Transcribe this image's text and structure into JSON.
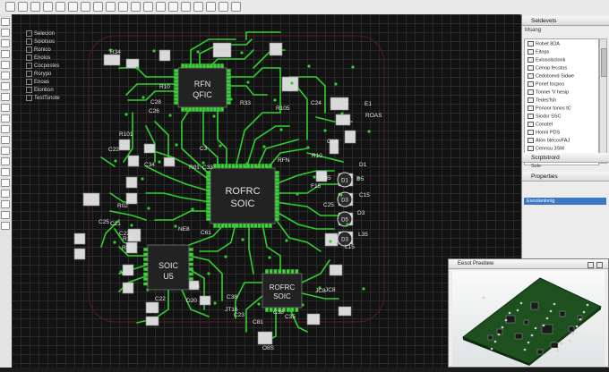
{
  "toolbar": {
    "icons": [
      "new-icon",
      "open-icon",
      "save-icon",
      "print-icon",
      "cut-icon",
      "copy-icon",
      "paste-icon",
      "undo-icon",
      "redo-icon",
      "zoom-in-icon",
      "zoom-out-icon",
      "route-icon",
      "grid-icon",
      "layer-icon",
      "drc-icon",
      "3d-icon",
      "export-icon",
      "settings-icon",
      "help-icon"
    ]
  },
  "left_toolbar": {
    "icons": [
      "pointer-icon",
      "select-icon",
      "move-icon",
      "wire-icon",
      "via-icon",
      "pad-icon",
      "arc-icon",
      "circle-icon",
      "text-icon",
      "dimension-icon",
      "polygon-icon",
      "keepout-icon",
      "measure-icon",
      "component-icon",
      "net-icon",
      "layer-icon",
      "zoom-icon",
      "pan-icon",
      "inspect-icon",
      "drc-icon"
    ]
  },
  "selection_panel": {
    "items": [
      "Selecion",
      "Solotsos",
      "Ronico",
      "Enolos",
      "Cocpostes",
      "Rorypo",
      "Enoas",
      "Elonbsn",
      "TestTsnote"
    ]
  },
  "board": {
    "chips": {
      "qfic": [
        "RFN",
        "QFIC"
      ],
      "soic_main": [
        "ROFRC",
        "SOIC"
      ],
      "soic_u5": [
        "SOIC",
        "U5"
      ],
      "soic_small": [
        "ROFRC",
        "SOIC"
      ]
    },
    "labels": [
      "R34",
      "R10",
      "C28",
      "C26",
      "R33",
      "R105",
      "C24",
      "R101",
      "C22",
      "C34",
      "C3",
      "R01",
      "C33",
      "R02",
      "C25",
      "C21",
      "C22",
      "NE8",
      "C61",
      "R32",
      "R33",
      "C23",
      "C22",
      "C38",
      "D20",
      "C38",
      "JT16",
      "C23",
      "C81",
      "C35",
      "C38",
      "JC8",
      "O8S",
      "JC8",
      "RFN",
      "R10",
      "C14",
      "F15",
      "C25",
      "L15",
      "L35",
      "C15",
      "D5",
      "D3",
      "D1",
      "X45",
      "E1",
      "ROAS"
    ],
    "resonators": [
      "D1",
      "D3",
      "D5",
      "D3",
      "D1"
    ]
  },
  "right_panel": {
    "selected_header": "Seldevets",
    "tree_title": "Msang",
    "tree_items": [
      "Robet 8DA",
      "Eitops",
      "Exlosolsclonk",
      "Cenop fecstos",
      "Cedotoevd Sidwe",
      "Ponet tocpos",
      "Tonnei 'V hesip",
      "Tedes'fsh",
      "Ponoor tonos tC",
      "Siodsr SSC",
      "Conotel",
      "Honni PDS",
      "Aton blecovFAJ",
      "Cennsu 3SM",
      "Tsibsun Tel"
    ],
    "schematic_header": "Scrptstrord",
    "schematic_item": "Sole",
    "properties_header": "Properties",
    "properties_selected": "Exoolanlonig"
  },
  "preview": {
    "title": "Eesot Preetiew"
  },
  "colors": {
    "trace": "#2ed12b",
    "canvas": "#121212",
    "chip": "#202020",
    "preview_board": "#1d4f1f"
  }
}
